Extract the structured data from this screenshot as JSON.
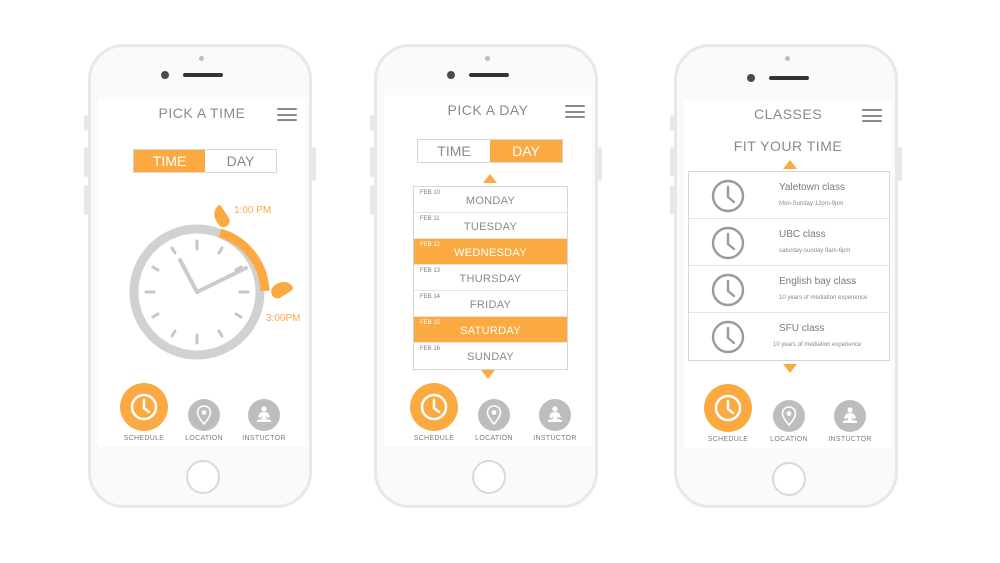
{
  "colors": {
    "accent": "#fbaa42",
    "gray": "#bdbdbd",
    "text": "#8a8a8a"
  },
  "screen1": {
    "title": "PICK A TIME",
    "toggle": {
      "time": "TIME",
      "day": "DAY",
      "active": "time"
    },
    "clock": {
      "start_label": "1:00 PM",
      "end_label": "3:00PM"
    }
  },
  "screen2": {
    "title": "PICK A DAY",
    "toggle": {
      "time": "TIME",
      "day": "DAY",
      "active": "day"
    },
    "days": [
      {
        "date": "FEB 10",
        "name": "MONDAY",
        "selected": false
      },
      {
        "date": "FEB 11",
        "name": "TUESDAY",
        "selected": false
      },
      {
        "date": "FEB 12",
        "name": "WEDNESDAY",
        "selected": true
      },
      {
        "date": "FEB 13",
        "name": "THURSDAY",
        "selected": false
      },
      {
        "date": "FEB 14",
        "name": "FRIDAY",
        "selected": false
      },
      {
        "date": "FEB 15",
        "name": "SATURDAY",
        "selected": true
      },
      {
        "date": "FEB 16",
        "name": "SUNDAY",
        "selected": false
      }
    ]
  },
  "screen3": {
    "title": "CLASSES",
    "subtitle": "FIT YOUR TIME",
    "classes": [
      {
        "name": "Yaletown class",
        "desc": "Mon-Sunday  12pm-9pm"
      },
      {
        "name": "UBC class",
        "desc": "saturday-sunday 9am-6pm"
      },
      {
        "name": "English bay class",
        "desc": "10 years of mediation experience"
      },
      {
        "name": "SFU class",
        "desc": "10 years of mediation experience"
      }
    ]
  },
  "nav": {
    "schedule": "SCHEDULE",
    "location": "LOCATION",
    "instructor": "INSTUCTOR",
    "icons": [
      "clock-icon",
      "location-pin-icon",
      "meditation-person-icon"
    ]
  }
}
